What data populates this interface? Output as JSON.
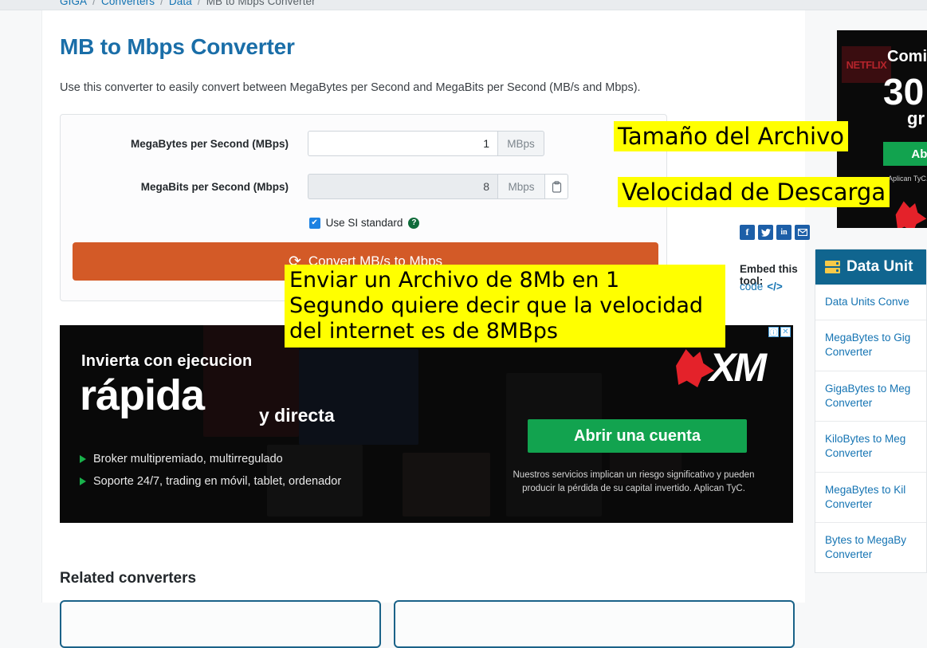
{
  "breadcrumb": {
    "items": [
      {
        "label": "GIGA",
        "current": false
      },
      {
        "label": "Converters",
        "current": false
      },
      {
        "label": "Data",
        "current": false
      },
      {
        "label": "MB to Mbps Converter",
        "current": true
      }
    ],
    "separator": "/"
  },
  "main": {
    "title": "MB to Mbps Converter",
    "description": "Use this converter to easily convert between MegaBytes per Second and MegaBits per Second (MB/s and Mbps).",
    "converter": {
      "row1": {
        "label": "MegaBytes per Second (MBps)",
        "value": "1",
        "unit": "MBps"
      },
      "row2": {
        "label": "MegaBits per Second (Mbps)",
        "value": "8",
        "unit": "Mbps",
        "copy_icon": "clipboard-icon"
      },
      "si_checkbox": {
        "label": "Use SI standard",
        "checked": true,
        "check_glyph": "✔",
        "help_glyph": "?"
      },
      "convert_button": {
        "label": "Convert MB/s to Mbps",
        "icon": "refresh-icon",
        "icon_glyph": "⟳",
        "color": "#d35a27"
      }
    },
    "share": {
      "icons": [
        {
          "name": "facebook-icon",
          "glyph": "f"
        },
        {
          "name": "twitter-icon",
          "glyph": "🐦"
        },
        {
          "name": "linkedin-icon",
          "glyph": "in"
        },
        {
          "name": "email-icon",
          "glyph": "✉"
        }
      ],
      "embed_title": "Embed this tool:",
      "embed_link": "code",
      "embed_code_glyph": "</>"
    },
    "related": {
      "heading": "Related converters"
    }
  },
  "ad_banner": {
    "headline1": "Invierta con ejecucion",
    "headline2": "rápida",
    "headline3": "y directa",
    "bullets": [
      "Broker multipremiado, multirregulado",
      "Soporte 24/7, trading en móvil, tablet, ordenador"
    ],
    "brand": "XM",
    "cta": "Abrir una cuenta",
    "disclaimer": "Nuestros servicios implican un riesgo significativo y pueden producir la pérdida de su capital invertido. Aplican TyC.",
    "info_glyph": "ⓘ",
    "close_glyph": "✕"
  },
  "rail_ad": {
    "netflix": "NETFLIX",
    "line1": "Comie",
    "line2": "30",
    "line3": "gr",
    "cta": "Abrir u",
    "disclaimer": "Aplican TyC. Bono n la UE"
  },
  "sidebar": {
    "title": "Data Unit",
    "icon": "server-icon",
    "items": [
      {
        "label": "Data Units Conve"
      },
      {
        "label": "MegaBytes to Gig Converter"
      },
      {
        "label": "GigaBytes to Meg Converter"
      },
      {
        "label": "KiloBytes to Meg Converter"
      },
      {
        "label": "MegaBytes to Kil Converter"
      },
      {
        "label": "Bytes to MegaBy Converter"
      }
    ]
  },
  "annotations": [
    {
      "id": "note-file-size",
      "text": "Tamaño del Archivo"
    },
    {
      "id": "note-download-speed",
      "text": "Velocidad de Descarga"
    },
    {
      "id": "note-explanation",
      "text": "Enviar un Archivo de 8Mb en 1 Segundo quiere decir que la velocidad del internet es de 8MBps"
    }
  ],
  "colors": {
    "accent_blue": "#1574b3",
    "title_blue": "#1a6ea8",
    "button_orange": "#d35a27",
    "panel_header": "#10658f",
    "highlight": "#ffff00"
  }
}
